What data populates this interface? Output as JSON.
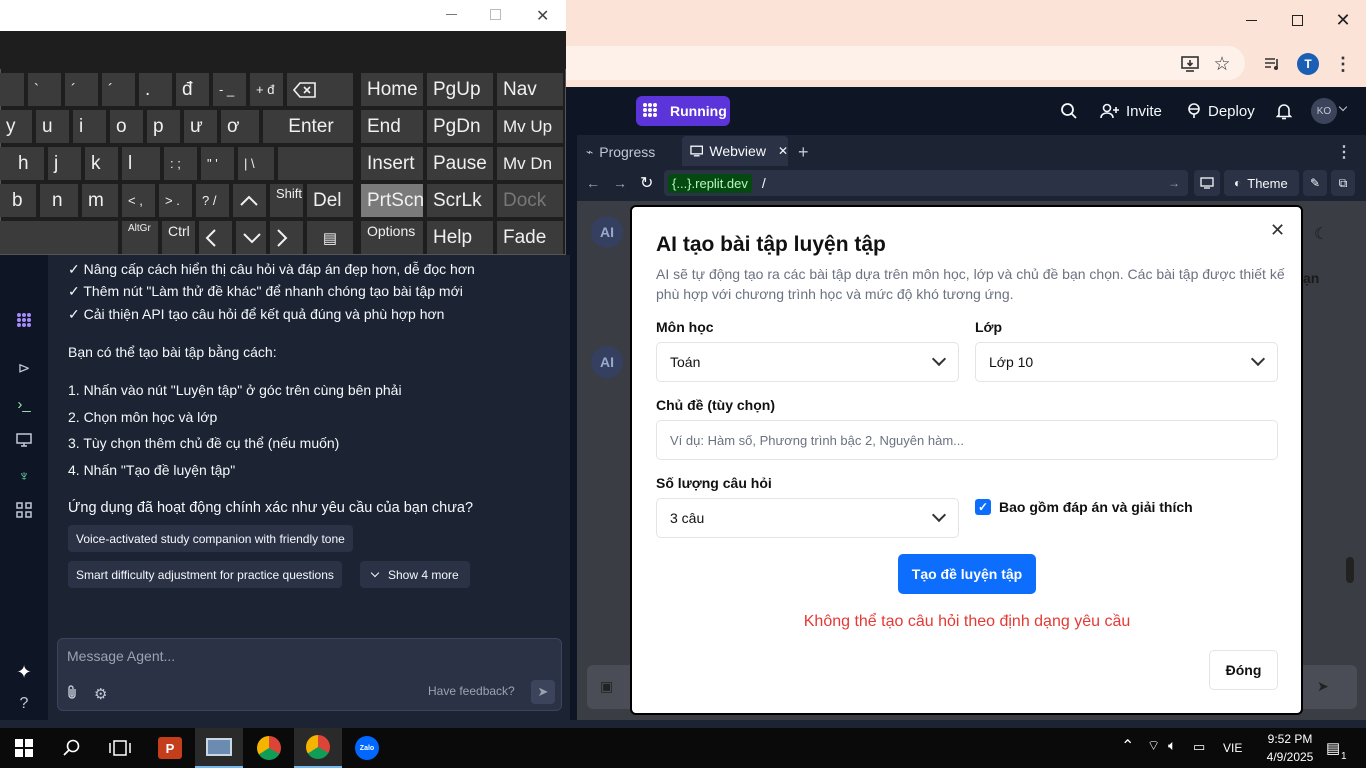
{
  "browser": {
    "window_controls": {
      "minimize": "—",
      "maximize": "❐",
      "close": "✕"
    },
    "profile_initial": "T"
  },
  "header": {
    "running_label": "Running",
    "invite_label": "Invite",
    "deploy_label": "Deploy",
    "avatar_initials": "KO"
  },
  "tabs": [
    {
      "label": "Progress"
    },
    {
      "label": "Webview"
    }
  ],
  "url_bar": {
    "domain": "{...}.replit.dev",
    "path": "/"
  },
  "theme_label": "Theme",
  "chat": {
    "lines": [
      "✓ Nâng cấp cách hiển thị câu hỏi và đáp án đẹp hơn, dễ đọc hơn",
      "✓ Thêm nút \"Làm thử đề khác\" để nhanh chóng tạo bài tập mới",
      "✓ Cải thiện API tạo câu hỏi để kết quả đúng và phù hợp hơn",
      "Bạn có thể tạo bài tập bằng cách:",
      "1. Nhấn vào nút \"Luyện tập\" ở góc trên cùng bên phải",
      "2. Chọn môn học và lớp",
      "3. Tùy chọn thêm chủ đề cụ thể (nếu muốn)",
      "4. Nhấn \"Tạo đề luyện tập\"",
      "Ứng dụng đã hoạt động chính xác như yêu cầu của bạn chưa?"
    ],
    "suggestions": [
      "Voice-activated study companion with friendly tone",
      "Smart difficulty adjustment for practice questions"
    ],
    "show_more": "Show 4 more",
    "message_placeholder": "Message Agent...",
    "feedback_label": "Have feedback?"
  },
  "webview_bg": {
    "avatar": "AI",
    "partial_text": "ạn"
  },
  "dialog": {
    "title": "AI tạo bài tập luyện tập",
    "description_line1": "AI sẽ tự động tạo ra các bài tập dựa trên môn học, lớp và chủ đề bạn chọn. Các bài tập được thiết kế",
    "description_line2": "phù hợp với chương trình học và mức độ khó tương ứng.",
    "subject_label": "Môn học",
    "subject_value": "Toán",
    "grade_label": "Lớp",
    "grade_value": "Lớp 10",
    "topic_label": "Chủ đề (tùy chọn)",
    "topic_placeholder": "Ví dụ: Hàm số, Phương trình bậc 2, Nguyên hàm...",
    "count_label": "Số lượng câu hỏi",
    "count_value": "3 câu",
    "include_answers_label": "Bao gồm đáp án và giải thích",
    "include_answers_checked": true,
    "generate_button": "Tạo đề luyện tập",
    "error_message": "Không thể tạo câu hỏi theo định dạng yêu cầu",
    "close_button": "Đóng",
    "primary_color": "#0d6efd",
    "error_color": "#e53935"
  },
  "keyboard": {
    "row1": [
      "`",
      "´",
      "´",
      ".",
      "đ",
      "- _",
      "+ đ"
    ],
    "row2": [
      "y",
      "u",
      "i",
      "o",
      "p",
      "ư",
      "ơ"
    ],
    "row3": [
      "h",
      "j",
      "k",
      "l",
      ": ;",
      "\" '",
      "| \\"
    ],
    "row4": [
      "b",
      "n",
      "m",
      "< ,",
      "> .",
      "? /"
    ],
    "enter": "Enter",
    "shift": "Shift",
    "del": "Del",
    "altgr": "AltGr",
    "ctrl": "Ctrl",
    "nav_keys": {
      "home": "Home",
      "pgup": "PgUp",
      "nav": "Nav",
      "end": "End",
      "pgdn": "PgDn",
      "mvup": "Mv Up",
      "insert": "Insert",
      "pause": "Pause",
      "mvdn": "Mv Dn",
      "prtscn": "PrtScn",
      "scrlk": "ScrLk",
      "dock": "Dock",
      "options": "Options",
      "help": "Help",
      "fade": "Fade"
    }
  },
  "taskbar": {
    "language": "VIE",
    "time": "9:52 PM",
    "date": "4/9/2025",
    "notification_count": "1",
    "zalo_label": "Zalo"
  }
}
